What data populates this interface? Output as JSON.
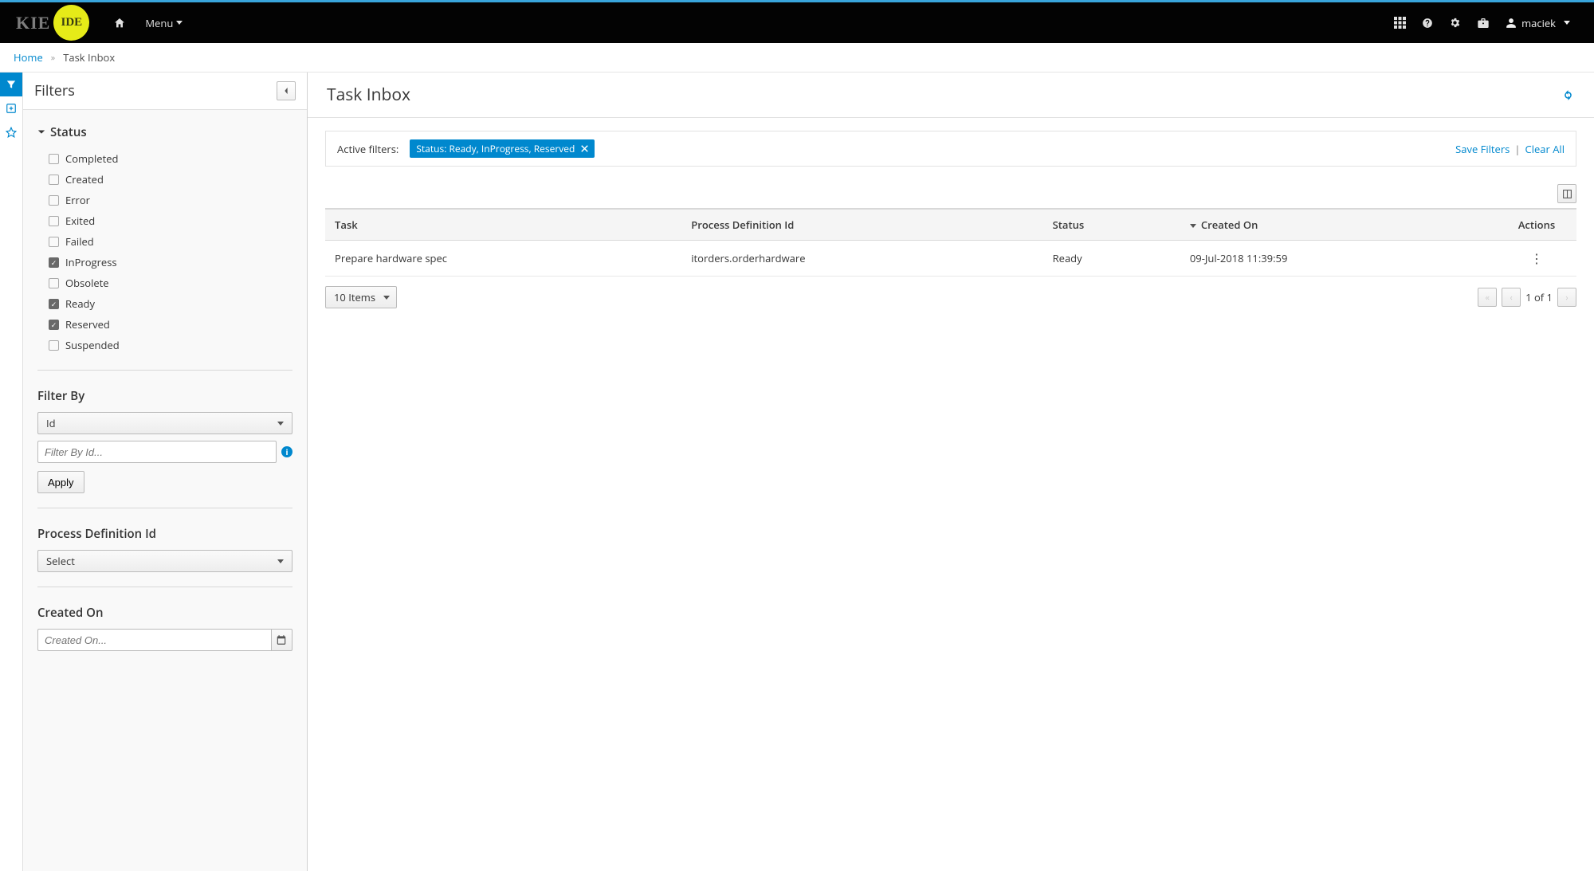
{
  "header": {
    "logo_left": "KIE",
    "logo_right": "IDE",
    "menu_label": "Menu",
    "user_name": "maciek"
  },
  "breadcrumb": {
    "home": "Home",
    "current": "Task Inbox"
  },
  "filters": {
    "title": "Filters",
    "status_heading": "Status",
    "status_items": [
      {
        "label": "Completed",
        "checked": false
      },
      {
        "label": "Created",
        "checked": false
      },
      {
        "label": "Error",
        "checked": false
      },
      {
        "label": "Exited",
        "checked": false
      },
      {
        "label": "Failed",
        "checked": false
      },
      {
        "label": "InProgress",
        "checked": true
      },
      {
        "label": "Obsolete",
        "checked": false
      },
      {
        "label": "Ready",
        "checked": true
      },
      {
        "label": "Reserved",
        "checked": true
      },
      {
        "label": "Suspended",
        "checked": false
      }
    ],
    "filter_by": {
      "heading": "Filter By",
      "selected": "Id",
      "placeholder": "Filter By Id...",
      "apply": "Apply"
    },
    "process_def": {
      "heading": "Process Definition Id",
      "selected": "Select"
    },
    "created_on": {
      "heading": "Created On",
      "placeholder": "Created On..."
    }
  },
  "content": {
    "title": "Task Inbox",
    "active_filters_label": "Active filters:",
    "chip_text": "Status: Ready, InProgress, Reserved",
    "save_filters": "Save Filters",
    "clear_all": "Clear All",
    "columns": {
      "task": "Task",
      "process_def_id": "Process Definition Id",
      "status": "Status",
      "created_on": "Created On",
      "actions": "Actions"
    },
    "rows": [
      {
        "task": "Prepare hardware spec",
        "process_def_id": "itorders.orderhardware",
        "status": "Ready",
        "created_on": "09-Jul-2018 11:39:59"
      }
    ],
    "page_size": "10 Items",
    "page_info": "1 of 1"
  }
}
